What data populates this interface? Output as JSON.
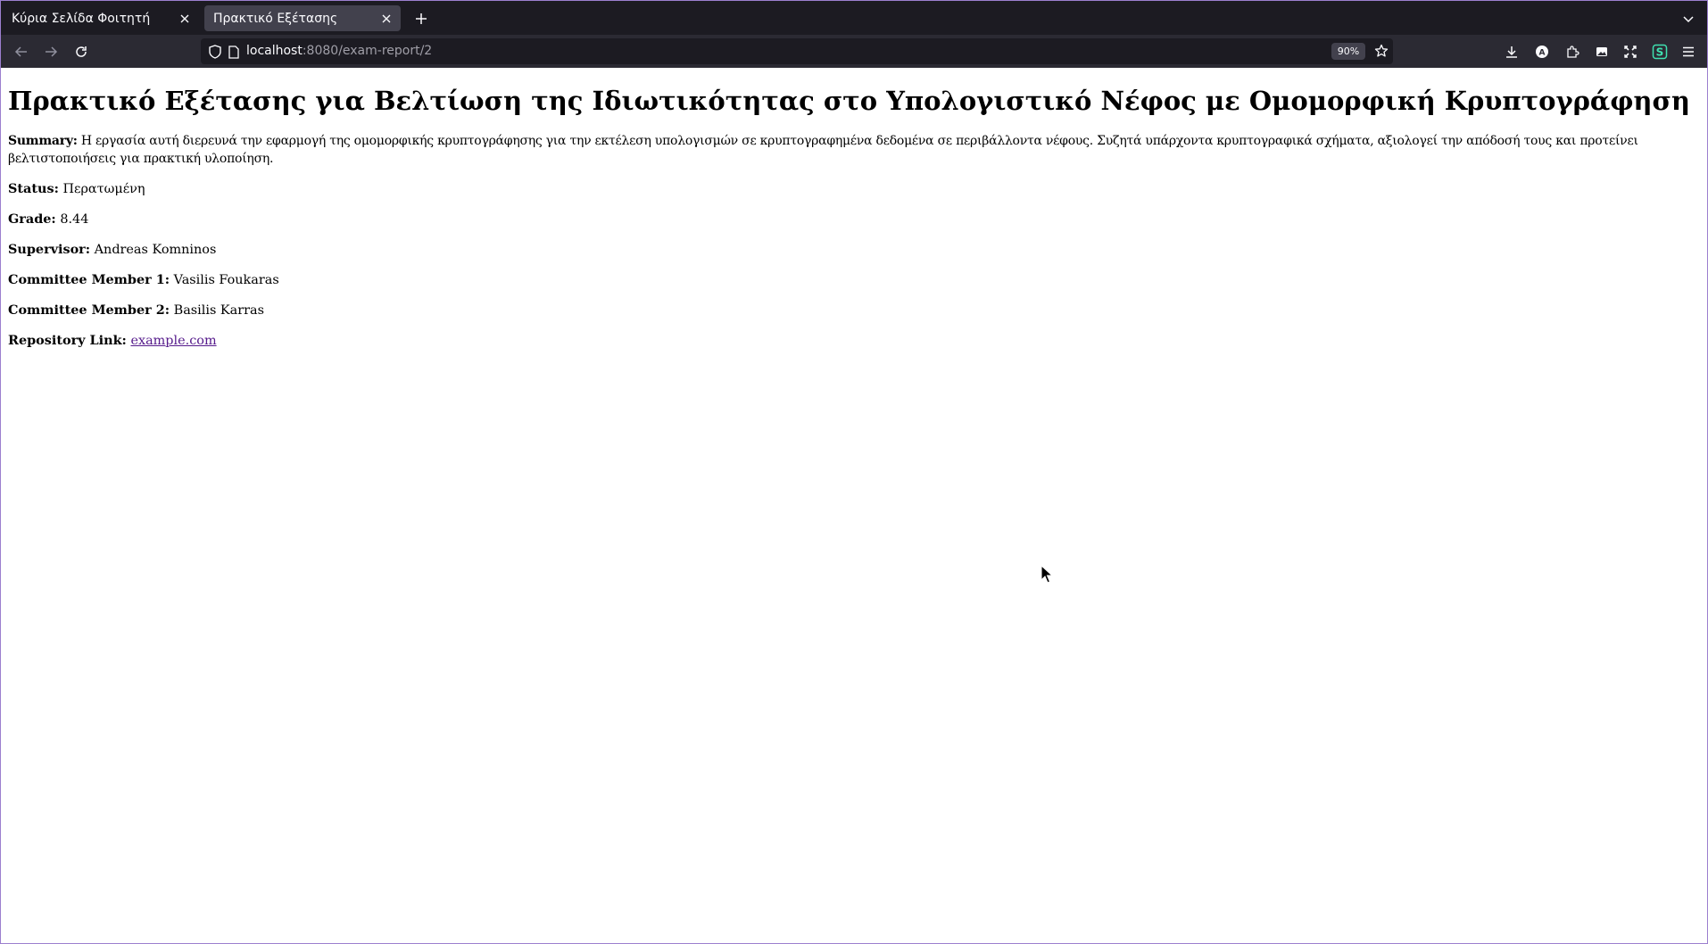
{
  "browser": {
    "tabs": [
      {
        "title": "Κύρια Σελίδα Φοιτητή",
        "active": false
      },
      {
        "title": "Πρακτικό Εξέτασης",
        "active": true
      }
    ],
    "url": {
      "host": "localhost",
      "rest": ":8080/exam-report/2"
    },
    "zoom": "90%",
    "icons": {
      "tab_close": "close-icon",
      "new_tab": "plus-icon",
      "tab_list": "chevron-down-icon",
      "back": "back-arrow-icon",
      "forward": "forward-arrow-icon",
      "reload": "reload-icon",
      "shield": "shield-icon",
      "page": "page-icon",
      "star": "star-icon",
      "downloads": "download-icon",
      "account": "account-icon",
      "extensions": "puzzle-icon",
      "menu": "hamburger-menu-icon"
    },
    "colors": {
      "chrome_dark": "#1c1b22",
      "toolbar": "#2b2a33",
      "active_tab": "#42414d",
      "frame_border": "#9c7fcf"
    }
  },
  "report": {
    "title": "Πρακτικό Εξέτασης για Βελτίωση της Ιδιωτικότητας στο Υπολογιστικό Νέφος με Ομομορφική Κρυπτογράφηση",
    "summary_label": "Summary:",
    "summary": "Η εργασία αυτή διερευνά την εφαρμογή της ομομορφικής κρυπτογράφησης για την εκτέλεση υπολογισμών σε κρυπτογραφημένα δεδομένα σε περιβάλλοντα νέφους. Συζητά υπάρχοντα κρυπτογραφικά σχήματα, αξιολογεί την απόδοσή τους και προτείνει βελτιστοποιήσεις για πρακτική υλοποίηση.",
    "status_label": "Status:",
    "status": "Περατωμένη",
    "grade_label": "Grade:",
    "grade": "8.44",
    "supervisor_label": "Supervisor:",
    "supervisor": "Andreas Komninos",
    "committee1_label": "Committee Member 1:",
    "committee1": "Vasilis Foukaras",
    "committee2_label": "Committee Member 2:",
    "committee2": "Basilis Karras",
    "repo_label": "Repository Link:",
    "repo_link": "example.com",
    "link_color": "#551a8b"
  }
}
